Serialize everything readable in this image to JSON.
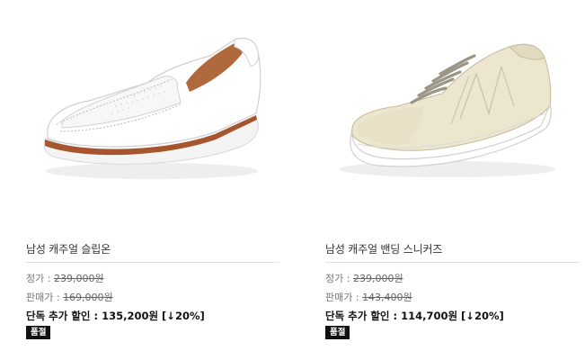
{
  "products": [
    {
      "name": "남성 캐주얼 슬립온",
      "regular_label": "정가 : ",
      "regular_price": "239,000원",
      "sale_label": "판매가 : ",
      "sale_price": "169,000원",
      "discount_text": "단독 추가 할인 : 135,200원 [↓20%]",
      "badge": "품절",
      "image_icon": "white-slip-on-shoe-icon"
    },
    {
      "name": "남성 캐주얼 밴딩 스니커즈",
      "regular_label": "정가 : ",
      "regular_price": "239,000원",
      "sale_label": "판매가 : ",
      "sale_price": "143,400원",
      "discount_text": "단독 추가 할인 : 114,700원 [↓20%]",
      "badge": "품절",
      "image_icon": "cream-banding-sneaker-icon"
    }
  ],
  "colors": {
    "text_primary": "#333333",
    "text_muted": "#777777",
    "badge_bg": "#111111",
    "divider": "#e2e2e2"
  }
}
